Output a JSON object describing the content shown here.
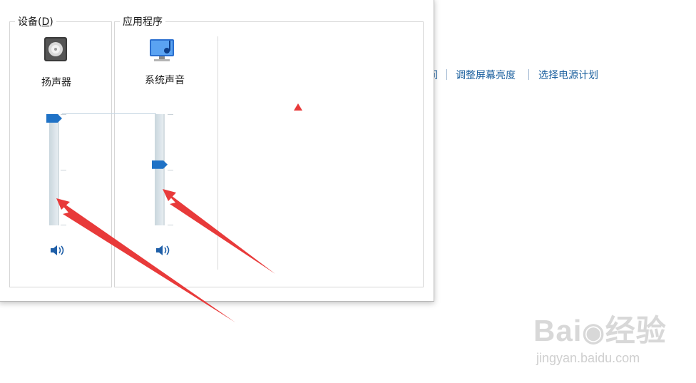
{
  "mixer": {
    "devices_group": {
      "label_main": "设备(",
      "label_key": "D",
      "label_end": ")"
    },
    "apps_group": {
      "label": "应用程序"
    },
    "device": {
      "name": "扬声器",
      "volume": 1.0,
      "icon": "speaker-box-icon"
    },
    "app": {
      "name": "系统声音",
      "volume": 0.55,
      "icon": "monitor-music-icon"
    },
    "mute_icon": "speaker-volume-icon"
  },
  "control_panel": {
    "links": [
      "调整屏幕亮度",
      "选择电源计划"
    ],
    "partial_text": "间"
  },
  "annotations": {
    "arrow_color": "#e83a3a"
  },
  "watermark": {
    "logo_text": "Bai",
    "logo_tail": "经验",
    "url": "jingyan.baidu.com"
  },
  "colors": {
    "accent": "#1f72c6",
    "link": "#1a5f9e"
  }
}
